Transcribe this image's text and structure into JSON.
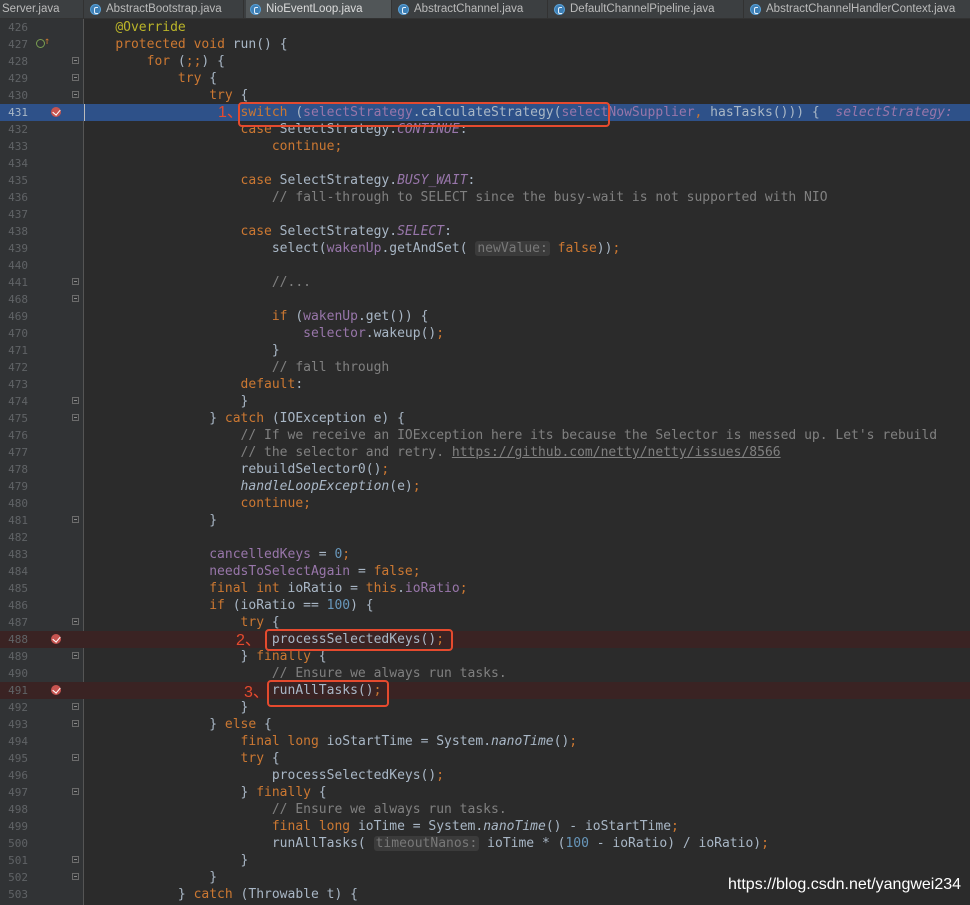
{
  "tabs": [
    {
      "label": "Server.java",
      "active": false
    },
    {
      "label": "AbstractBootstrap.java",
      "active": false
    },
    {
      "label": "NioEventLoop.java",
      "active": true
    },
    {
      "label": "AbstractChannel.java",
      "active": false
    },
    {
      "label": "DefaultChannelPipeline.java",
      "active": false
    },
    {
      "label": "AbstractChannelHandlerContext.java",
      "active": false
    }
  ],
  "annotations": {
    "step1": "1、",
    "step2": "2、",
    "step3": "3、"
  },
  "watermark": "https://blog.csdn.net/yangwei234",
  "colors": {
    "keyword": "#cc7832",
    "number": "#6897bb",
    "field": "#9876aa",
    "comment": "#808080",
    "selection": "#2e5189",
    "breakpoint_row": "#3a2323",
    "annotation_box": "#e54a2e"
  },
  "code": [
    {
      "ln": "426",
      "text": "    @Override"
    },
    {
      "ln": "427",
      "text": "    protected void run() {"
    },
    {
      "ln": "428",
      "text": "        for (;;) {"
    },
    {
      "ln": "429",
      "text": "            try {"
    },
    {
      "ln": "430",
      "text": "                try {"
    },
    {
      "ln": "431",
      "text": "                    switch (selectStrategy.calculateStrategy(selectNowSupplier, hasTasks())) {  selectStrategy:"
    },
    {
      "ln": "432",
      "text": "                    case SelectStrategy.CONTINUE:"
    },
    {
      "ln": "433",
      "text": "                        continue;"
    },
    {
      "ln": "434",
      "text": ""
    },
    {
      "ln": "435",
      "text": "                    case SelectStrategy.BUSY_WAIT:"
    },
    {
      "ln": "436",
      "text": "                        // fall-through to SELECT since the busy-wait is not supported with NIO"
    },
    {
      "ln": "437",
      "text": ""
    },
    {
      "ln": "438",
      "text": "                    case SelectStrategy.SELECT:"
    },
    {
      "ln": "439",
      "text": "                        select(wakenUp.getAndSet( newValue: false));"
    },
    {
      "ln": "440",
      "text": ""
    },
    {
      "ln": "441",
      "text": "                        //..."
    },
    {
      "ln": "468",
      "text": ""
    },
    {
      "ln": "469",
      "text": "                        if (wakenUp.get()) {"
    },
    {
      "ln": "470",
      "text": "                            selector.wakeup();"
    },
    {
      "ln": "471",
      "text": "                        }"
    },
    {
      "ln": "472",
      "text": "                        // fall through"
    },
    {
      "ln": "473",
      "text": "                    default:"
    },
    {
      "ln": "474",
      "text": "                    }"
    },
    {
      "ln": "475",
      "text": "                } catch (IOException e) {"
    },
    {
      "ln": "476",
      "text": "                    // If we receive an IOException here its because the Selector is messed up. Let's rebuild"
    },
    {
      "ln": "477",
      "text": "                    // the selector and retry. https://github.com/netty/netty/issues/8566"
    },
    {
      "ln": "478",
      "text": "                    rebuildSelector0();"
    },
    {
      "ln": "479",
      "text": "                    handleLoopException(e);"
    },
    {
      "ln": "480",
      "text": "                    continue;"
    },
    {
      "ln": "481",
      "text": "                }"
    },
    {
      "ln": "482",
      "text": ""
    },
    {
      "ln": "483",
      "text": "                cancelledKeys = 0;"
    },
    {
      "ln": "484",
      "text": "                needsToSelectAgain = false;"
    },
    {
      "ln": "485",
      "text": "                final int ioRatio = this.ioRatio;"
    },
    {
      "ln": "486",
      "text": "                if (ioRatio == 100) {"
    },
    {
      "ln": "487",
      "text": "                    try {"
    },
    {
      "ln": "488",
      "text": "                        processSelectedKeys();"
    },
    {
      "ln": "489",
      "text": "                    } finally {"
    },
    {
      "ln": "490",
      "text": "                        // Ensure we always run tasks."
    },
    {
      "ln": "491",
      "text": "                        runAllTasks();"
    },
    {
      "ln": "492",
      "text": "                    }"
    },
    {
      "ln": "493",
      "text": "                } else {"
    },
    {
      "ln": "494",
      "text": "                    final long ioStartTime = System.nanoTime();"
    },
    {
      "ln": "495",
      "text": "                    try {"
    },
    {
      "ln": "496",
      "text": "                        processSelectedKeys();"
    },
    {
      "ln": "497",
      "text": "                    } finally {"
    },
    {
      "ln": "498",
      "text": "                        // Ensure we always run tasks."
    },
    {
      "ln": "499",
      "text": "                        final long ioTime = System.nanoTime() - ioStartTime;"
    },
    {
      "ln": "500",
      "text": "                        runAllTasks( timeoutNanos: ioTime * (100 - ioRatio) / ioRatio);"
    },
    {
      "ln": "501",
      "text": "                    }"
    },
    {
      "ln": "502",
      "text": "                }"
    },
    {
      "ln": "503",
      "text": "            } catch (Throwable t) {"
    }
  ]
}
